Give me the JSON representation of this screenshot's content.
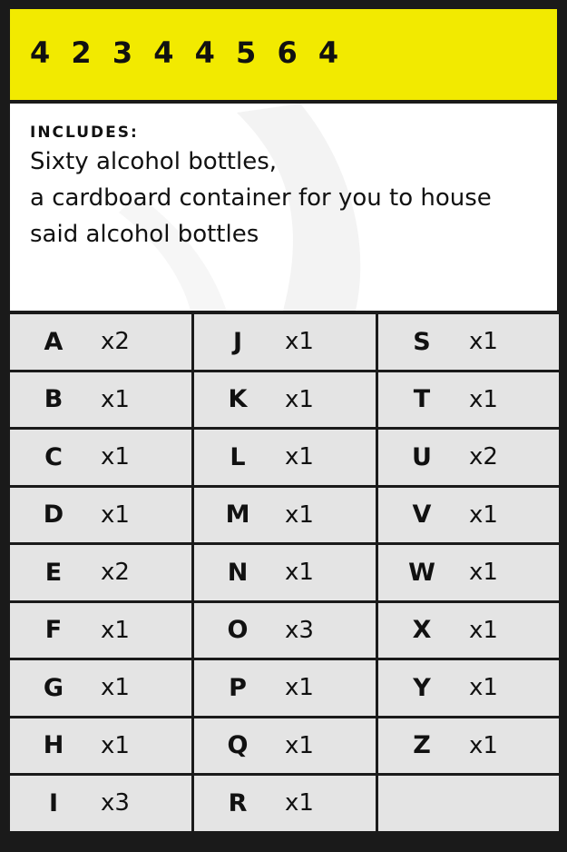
{
  "header": {
    "code": "4 2 3 4 4 5 6 4",
    "background": "#f2ea00"
  },
  "includes": {
    "label": "INCLUDES:",
    "lines": [
      "Sixty alcohol bottles,",
      "a cardboard container for you to house",
      "said alcohol bottles"
    ]
  },
  "columns": [
    [
      {
        "letter": "A",
        "qty": "x2"
      },
      {
        "letter": "B",
        "qty": "x1"
      },
      {
        "letter": "C",
        "qty": "x1"
      },
      {
        "letter": "D",
        "qty": "x1"
      },
      {
        "letter": "E",
        "qty": "x2"
      },
      {
        "letter": "F",
        "qty": "x1"
      },
      {
        "letter": "G",
        "qty": "x1"
      },
      {
        "letter": "H",
        "qty": "x1"
      },
      {
        "letter": "I",
        "qty": "x3"
      }
    ],
    [
      {
        "letter": "J",
        "qty": "x1"
      },
      {
        "letter": "K",
        "qty": "x1"
      },
      {
        "letter": "L",
        "qty": "x1"
      },
      {
        "letter": "M",
        "qty": "x1"
      },
      {
        "letter": "N",
        "qty": "x1"
      },
      {
        "letter": "O",
        "qty": "x3"
      },
      {
        "letter": "P",
        "qty": "x1"
      },
      {
        "letter": "Q",
        "qty": "x1"
      },
      {
        "letter": "R",
        "qty": "x1"
      }
    ],
    [
      {
        "letter": "S",
        "qty": "x1"
      },
      {
        "letter": "T",
        "qty": "x1"
      },
      {
        "letter": "U",
        "qty": "x2"
      },
      {
        "letter": "V",
        "qty": "x1"
      },
      {
        "letter": "W",
        "qty": "x1"
      },
      {
        "letter": "X",
        "qty": "x1"
      },
      {
        "letter": "Y",
        "qty": "x1"
      },
      {
        "letter": "Z",
        "qty": "x1"
      },
      {
        "letter": "",
        "qty": ""
      }
    ]
  ]
}
